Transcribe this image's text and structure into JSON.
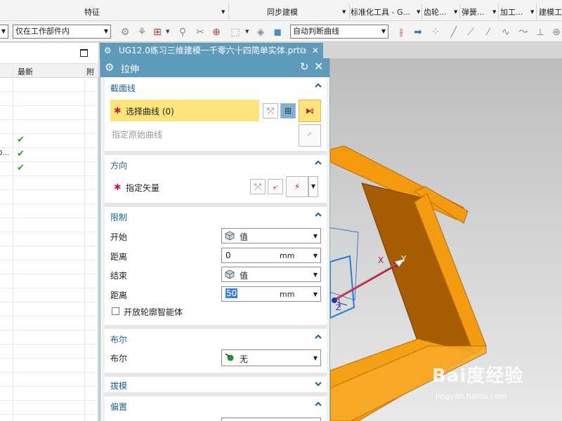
{
  "ribbon": {
    "groups": [
      {
        "label": "特征"
      },
      {
        "label": "同步建模"
      },
      {
        "label": "标准化工具 - G..."
      },
      {
        "label": "齿轮..."
      },
      {
        "label": "弹簧..."
      },
      {
        "label": "加工..."
      },
      {
        "label": "建模工"
      }
    ]
  },
  "toolbar": {
    "filter_combo": "",
    "scope_combo": "仅在工作部件内",
    "curve_rule_combo": "自动判断曲线"
  },
  "navigator": {
    "columns": [
      "最新",
      "附"
    ],
    "rows": [
      {
        "name": "",
        "latest": false
      },
      {
        "name": "",
        "latest": false
      },
      {
        "name": "",
        "latest": false
      },
      {
        "name": "",
        "latest": false
      },
      {
        "name": "",
        "latest": true
      },
      {
        "name": "0...",
        "latest": true
      },
      {
        "name": "",
        "latest": true
      },
      {
        "name": "",
        "latest": false
      },
      {
        "name": "",
        "latest": false
      },
      {
        "name": "",
        "latest": false
      },
      {
        "name": "",
        "latest": false
      },
      {
        "name": "",
        "latest": false
      },
      {
        "name": "",
        "latest": false
      },
      {
        "name": "",
        "latest": false
      },
      {
        "name": "",
        "latest": false
      },
      {
        "name": "",
        "latest": false
      },
      {
        "name": "",
        "latest": false
      },
      {
        "name": "",
        "latest": false
      },
      {
        "name": "",
        "latest": false
      },
      {
        "name": "",
        "latest": false
      },
      {
        "name": "",
        "latest": false
      },
      {
        "name": "",
        "latest": false
      },
      {
        "name": "",
        "latest": false
      },
      {
        "name": "",
        "latest": false
      },
      {
        "name": "",
        "latest": false
      }
    ]
  },
  "document_tab": {
    "title": "UG12.0练习三维建模一千零六十四简单实体.prt"
  },
  "dialog": {
    "title": "拉伸",
    "section": {
      "title": "截面线",
      "select_curve": "选择曲线 (0)",
      "specify_origin": "指定原始曲线"
    },
    "direction": {
      "title": "方向",
      "specify_vector": "指定矢量"
    },
    "limits": {
      "title": "限制",
      "start_label": "开始",
      "start_value": "值",
      "start_distance_label": "距离",
      "start_distance": "0",
      "end_label": "结束",
      "end_value": "值",
      "end_distance_label": "距离",
      "end_distance": "50",
      "unit": "mm",
      "open_profile": "开放轮廓智能体"
    },
    "boolean": {
      "title": "布尔",
      "label": "布尔",
      "value": "无"
    },
    "draft": {
      "title": "拔模"
    },
    "offset": {
      "title": "偏置"
    }
  },
  "graphics": {
    "axis_x": "X",
    "axis_y": "Y",
    "axis_z": "Z",
    "model_color": "#f59a0e",
    "watermark_logo": "Bai度经验",
    "watermark_url": "jingyan.baidu.com"
  },
  "colors": {
    "accent": "#5e9bbb",
    "required": "#c8102e",
    "highlight": "#fde37a",
    "check": "#2fa52f"
  }
}
